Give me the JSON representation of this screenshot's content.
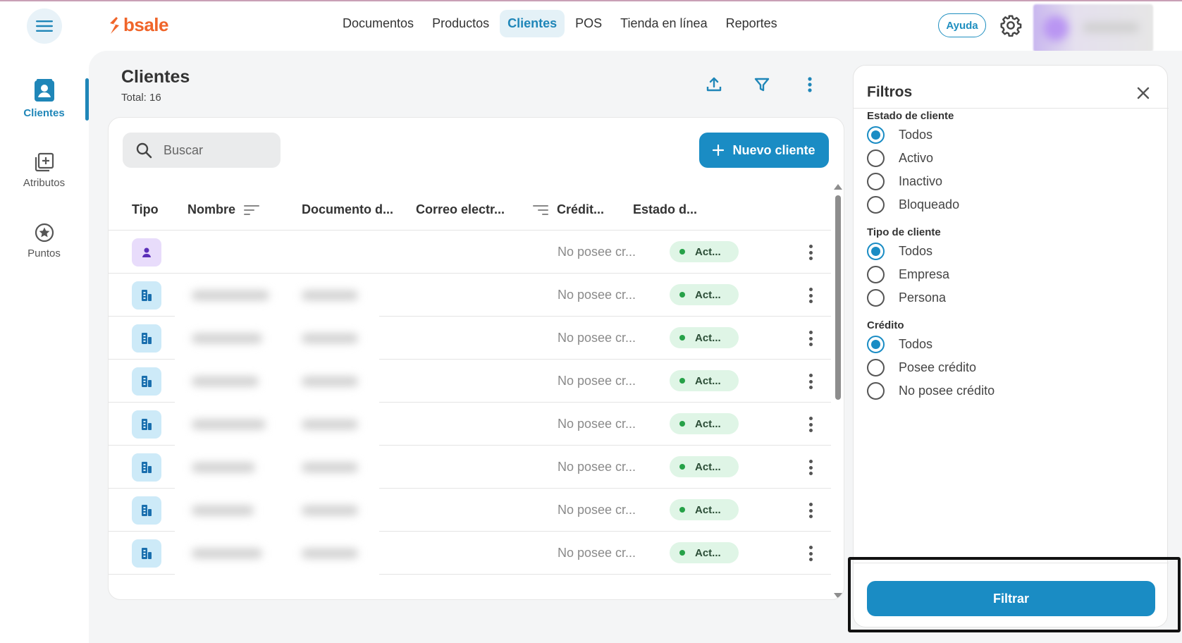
{
  "colors": {
    "accent": "#1a8cc4",
    "brand": "#f0652a",
    "status_active": "#26a148"
  },
  "logo": {
    "text": "bsale"
  },
  "topnav": {
    "items": [
      {
        "label": "Documentos",
        "active": false
      },
      {
        "label": "Productos",
        "active": false
      },
      {
        "label": "Clientes",
        "active": true
      },
      {
        "label": "POS",
        "active": false
      },
      {
        "label": "Tienda en línea",
        "active": false
      },
      {
        "label": "Reportes",
        "active": false
      }
    ],
    "help_label": "Ayuda"
  },
  "rail": {
    "items": [
      {
        "label": "Clientes",
        "icon": "contact-card-icon",
        "active": true
      },
      {
        "label": "Atributos",
        "icon": "add-library-icon",
        "active": false
      },
      {
        "label": "Puntos",
        "icon": "star-circle-icon",
        "active": false
      }
    ]
  },
  "page": {
    "title": "Clientes",
    "total": "Total: 16"
  },
  "search": {
    "placeholder": "Buscar"
  },
  "new_client_label": "Nuevo cliente",
  "table": {
    "columns": [
      "Tipo",
      "Nombre",
      "Documento d...",
      "Correo electr...",
      "Crédit...",
      "Estado d..."
    ],
    "rows": [
      {
        "type": "person",
        "credit": "No posee cr...",
        "status": "Act..."
      },
      {
        "type": "company",
        "credit": "No posee cr...",
        "status": "Act..."
      },
      {
        "type": "company",
        "credit": "No posee cr...",
        "status": "Act..."
      },
      {
        "type": "company",
        "credit": "No posee cr...",
        "status": "Act..."
      },
      {
        "type": "company",
        "credit": "No posee cr...",
        "status": "Act..."
      },
      {
        "type": "company",
        "credit": "No posee cr...",
        "status": "Act..."
      },
      {
        "type": "company",
        "credit": "No posee cr...",
        "status": "Act..."
      },
      {
        "type": "company",
        "credit": "No posee cr...",
        "status": "Act..."
      }
    ]
  },
  "filters": {
    "title": "Filtros",
    "sections": [
      {
        "title": "Estado de cliente",
        "options": [
          "Todos",
          "Activo",
          "Inactivo",
          "Bloqueado"
        ],
        "selected": "Todos"
      },
      {
        "title": "Tipo de cliente",
        "options": [
          "Todos",
          "Empresa",
          "Persona"
        ],
        "selected": "Todos"
      },
      {
        "title": "Crédito",
        "options": [
          "Todos",
          "Posee crédito",
          "No posee crédito"
        ],
        "selected": "Todos"
      }
    ],
    "apply_label": "Filtrar"
  }
}
